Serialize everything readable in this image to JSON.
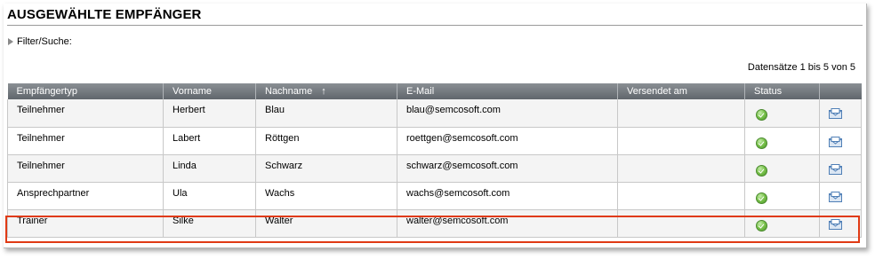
{
  "panel": {
    "title": "AUSGEWÄHLTE EMPFÄNGER",
    "filter_label": "Filter/Suche:",
    "records_info": "Datensätze 1 bis 5 von 5"
  },
  "table": {
    "columns": [
      "Empfängertyp",
      "Vorname",
      "Nachname",
      "E-Mail",
      "Versendet am",
      "Status",
      ""
    ],
    "sort_indicator": "↑",
    "rows": [
      {
        "type": "Teilnehmer",
        "first": "Herbert",
        "last": "Blau",
        "email": "blau@semcosoft.com",
        "sent": "",
        "status": "ok"
      },
      {
        "type": "Teilnehmer",
        "first": "Labert",
        "last": "Röttgen",
        "email": "roettgen@semcosoft.com",
        "sent": "",
        "status": "ok"
      },
      {
        "type": "Teilnehmer",
        "first": "Linda",
        "last": "Schwarz",
        "email": "schwarz@semcosoft.com",
        "sent": "",
        "status": "ok"
      },
      {
        "type": "Ansprechpartner",
        "first": "Ula",
        "last": "Wachs",
        "email": "wachs@semcosoft.com",
        "sent": "",
        "status": "ok"
      },
      {
        "type": "Trainer",
        "first": "Silke",
        "last": "Walter",
        "email": "walter@semcosoft.com",
        "sent": "",
        "status": "ok"
      }
    ]
  },
  "icons": {
    "filter": "triangle-right-icon",
    "status": "green-check-icon",
    "action": "mail-icon"
  },
  "colors": {
    "header_bg": "#6e7378",
    "highlight_border": "#e03a14",
    "status_green": "#7cc44e"
  }
}
